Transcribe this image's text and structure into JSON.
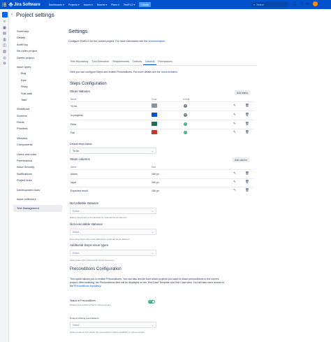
{
  "topnav": {
    "product": "Jira Software",
    "items": [
      "Dashboards ▾",
      "Projects ▾",
      "Issues ▾",
      "Boards ▾",
      "Plans ▾",
      "TestFLO ▾"
    ],
    "create": "Create",
    "search_placeholder": "Search"
  },
  "page_title": "Project settings",
  "sidebar": {
    "group1": [
      "Summary",
      "Details",
      "Audit log",
      "Re-index project",
      "Delete project"
    ],
    "issue_types_header": "Issue types",
    "issue_types": [
      "Bug",
      "Epic",
      "Story",
      "Sub-task",
      "Task"
    ],
    "group2": [
      "Workflows",
      "Screens",
      "Fields",
      "Priorities"
    ],
    "group3": [
      "Versions",
      "Components"
    ],
    "group4": [
      "Users and roles",
      "Permissions",
      "Issue Security",
      "Notifications",
      "Project links"
    ],
    "group5": [
      "Development tools"
    ],
    "group6": [
      "Issue collectors"
    ],
    "active": "Test Management"
  },
  "main": {
    "title": "Settings",
    "desc_prefix": "Configure TestFLO for the current project. For more information see the ",
    "desc_link": "documentation",
    "desc_suffix": "."
  },
  "tabs": [
    "Test Repository",
    "Test Execution",
    "Requirements",
    "Defects",
    "General",
    "Permissions"
  ],
  "active_tab": "General",
  "general": {
    "intro_prefix": "Here you can configure Steps and enable Preconditions. For more details see the ",
    "intro_link": "documentation",
    "intro_suffix": ".",
    "steps_config_title": "Steps Configuration",
    "steps_statuses_title": "Steps statuses",
    "add_status": "Add status",
    "status_columns": {
      "name": "Name",
      "color": "Color",
      "is_final": "Is final"
    },
    "statuses": [
      {
        "name": "To do",
        "color": "#8993a4",
        "final": "x"
      },
      {
        "name": "In progress",
        "color": "#0052cc",
        "final": "x"
      },
      {
        "name": "Pass",
        "color": "#216e4e",
        "final": "✓"
      },
      {
        "name": "Fail",
        "color": "#c9372c",
        "final": "✓"
      }
    ],
    "default_status_label": "Default steps status",
    "default_status_value": "To do",
    "steps_columns_title": "Steps columns",
    "add_column": "Add column",
    "column_headers": {
      "name": "Name",
      "size": "Size"
    },
    "columns": [
      {
        "name": "Action",
        "size": "150 px"
      },
      {
        "name": "Input",
        "size": "150 px"
      },
      {
        "name": "Expected result",
        "size": "150 px"
      }
    ],
    "not_editable_title": "Not editable statuses",
    "not_editable_placeholder": "Select...",
    "not_editable_help": "Editing Steps will not be allowed for selected issue statuses",
    "not_executable_title": "Not executable statuses",
    "not_executable_placeholder": "Select...",
    "not_executable_help": "Executing Steps will not be allowed for selected issue statuses",
    "additional_types_title": "Additional Steps issue types",
    "additional_types_placeholder": "Select...",
    "additional_types_help": "Steps issue types will contain Steps resources",
    "preconditions_title": "Preconditions Configuration",
    "preconditions_text_1": "This option allows you to enable Preconditions. You can also decide from which projects you want to share preconditions in the current",
    "preconditions_text_2": "project. After enabling, the Preconditions field will be displayed on the Test Case Template and Test Case view. You will also have access to",
    "preconditions_text_3_prefix": "the ",
    "preconditions_text_3_link": "Preconditions repository",
    "preconditions_text_3_suffix": ".",
    "status_of_preconditions": "Status of Preconditions",
    "status_of_preconditions_help": "Enable Preconditions Tab in current project",
    "projects_sharing_label": "Projects sharing preconditions",
    "projects_sharing_placeholder": "Select...",
    "projects_sharing_help": "Select projects from which the preconditions will be available in current project"
  }
}
